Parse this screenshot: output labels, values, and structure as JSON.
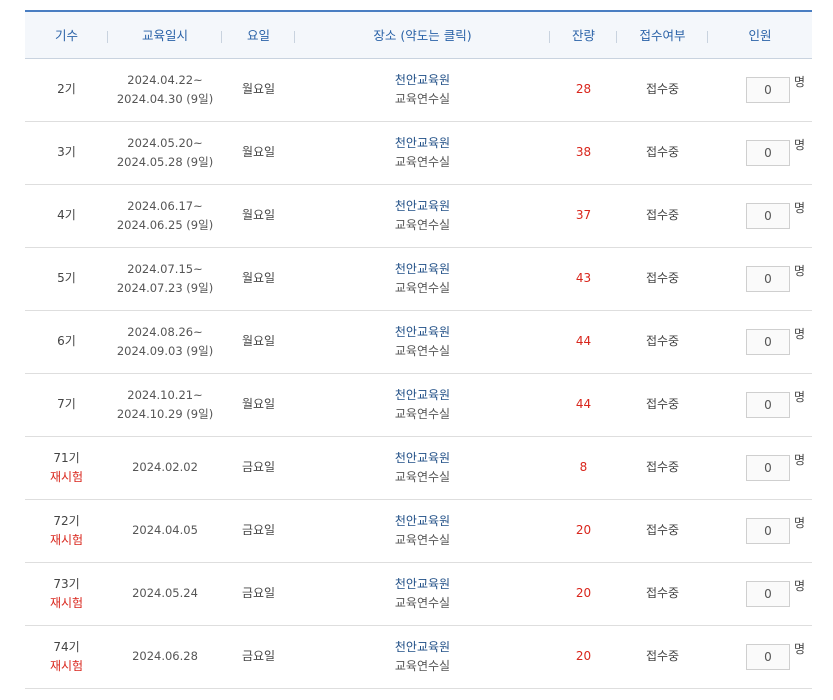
{
  "headers": {
    "term": "기수",
    "date": "교육일시",
    "weekday": "요일",
    "place": "장소 (약도는 클릭)",
    "remain": "잔량",
    "status": "접수여부",
    "people": "인원"
  },
  "rows": [
    {
      "term": "2기",
      "retest": "",
      "date1": "2024.04.22~",
      "date2": "2024.04.30 (9일)",
      "weekday": "월요일",
      "place1": "천안교육원",
      "place2": "교육연수실",
      "remain": "28",
      "status": "접수중",
      "qty": "0",
      "unit": "명"
    },
    {
      "term": "3기",
      "retest": "",
      "date1": "2024.05.20~",
      "date2": "2024.05.28 (9일)",
      "weekday": "월요일",
      "place1": "천안교육원",
      "place2": "교육연수실",
      "remain": "38",
      "status": "접수중",
      "qty": "0",
      "unit": "명"
    },
    {
      "term": "4기",
      "retest": "",
      "date1": "2024.06.17~",
      "date2": "2024.06.25 (9일)",
      "weekday": "월요일",
      "place1": "천안교육원",
      "place2": "교육연수실",
      "remain": "37",
      "status": "접수중",
      "qty": "0",
      "unit": "명"
    },
    {
      "term": "5기",
      "retest": "",
      "date1": "2024.07.15~",
      "date2": "2024.07.23 (9일)",
      "weekday": "월요일",
      "place1": "천안교육원",
      "place2": "교육연수실",
      "remain": "43",
      "status": "접수중",
      "qty": "0",
      "unit": "명"
    },
    {
      "term": "6기",
      "retest": "",
      "date1": "2024.08.26~",
      "date2": "2024.09.03 (9일)",
      "weekday": "월요일",
      "place1": "천안교육원",
      "place2": "교육연수실",
      "remain": "44",
      "status": "접수중",
      "qty": "0",
      "unit": "명"
    },
    {
      "term": "7기",
      "retest": "",
      "date1": "2024.10.21~",
      "date2": "2024.10.29 (9일)",
      "weekday": "월요일",
      "place1": "천안교육원",
      "place2": "교육연수실",
      "remain": "44",
      "status": "접수중",
      "qty": "0",
      "unit": "명"
    },
    {
      "term": "71기",
      "retest": "재시험",
      "date1": "2024.02.02",
      "date2": "",
      "weekday": "금요일",
      "place1": "천안교육원",
      "place2": "교육연수실",
      "remain": "8",
      "status": "접수중",
      "qty": "0",
      "unit": "명"
    },
    {
      "term": "72기",
      "retest": "재시험",
      "date1": "2024.04.05",
      "date2": "",
      "weekday": "금요일",
      "place1": "천안교육원",
      "place2": "교육연수실",
      "remain": "20",
      "status": "접수중",
      "qty": "0",
      "unit": "명"
    },
    {
      "term": "73기",
      "retest": "재시험",
      "date1": "2024.05.24",
      "date2": "",
      "weekday": "금요일",
      "place1": "천안교육원",
      "place2": "교육연수실",
      "remain": "20",
      "status": "접수중",
      "qty": "0",
      "unit": "명"
    },
    {
      "term": "74기",
      "retest": "재시험",
      "date1": "2024.06.28",
      "date2": "",
      "weekday": "금요일",
      "place1": "천안교육원",
      "place2": "교육연수실",
      "remain": "20",
      "status": "접수중",
      "qty": "0",
      "unit": "명"
    }
  ],
  "colors": {
    "header_text": "#2b63a8",
    "accent_red": "#d9261c",
    "place_link": "#1f4e86",
    "top_border": "#4a7ec2"
  }
}
